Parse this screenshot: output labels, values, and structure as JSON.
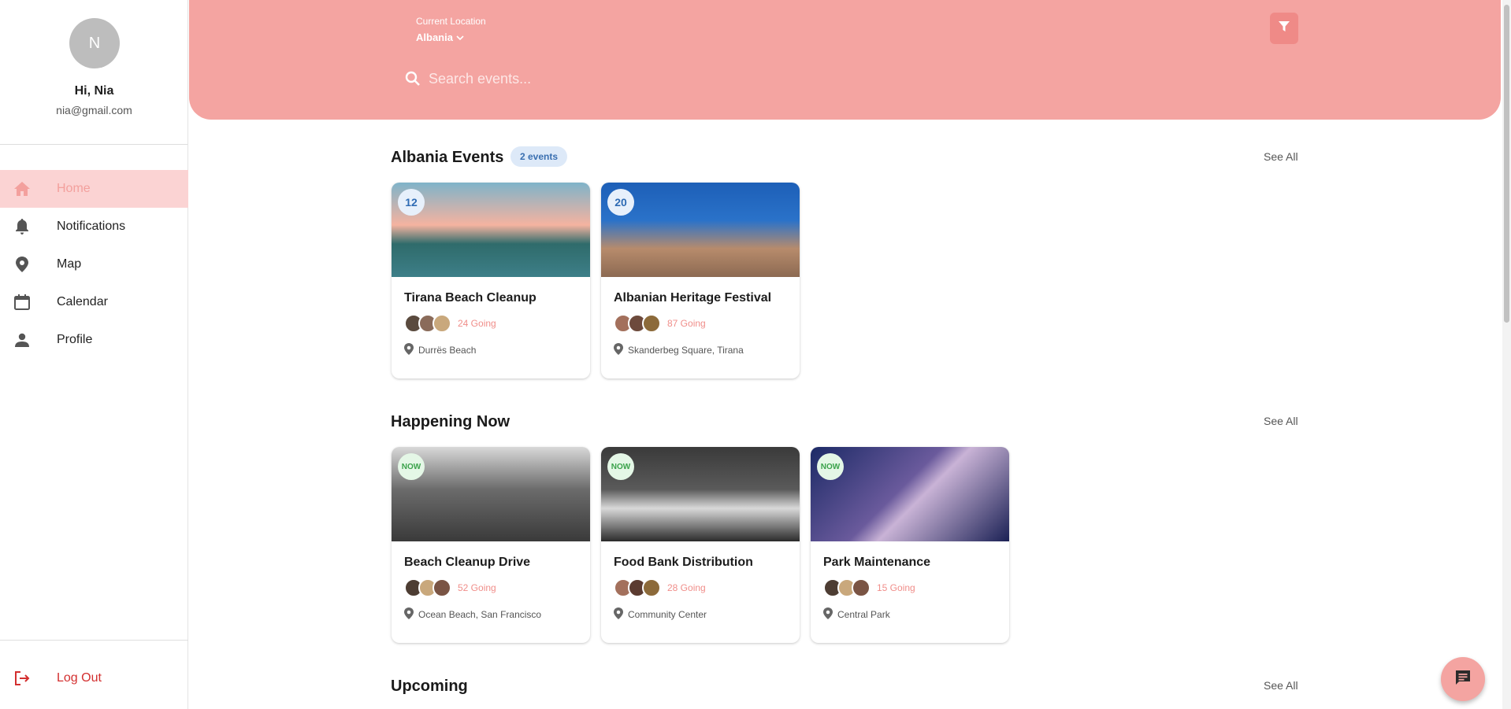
{
  "user": {
    "initial": "N",
    "greeting": "Hi, Nia",
    "email": "nia@gmail.com"
  },
  "nav": {
    "items": [
      {
        "label": "Home",
        "icon": "home-icon",
        "active": true
      },
      {
        "label": "Notifications",
        "icon": "bell-icon"
      },
      {
        "label": "Map",
        "icon": "map-pin-icon"
      },
      {
        "label": "Calendar",
        "icon": "calendar-icon"
      },
      {
        "label": "Profile",
        "icon": "person-icon"
      }
    ],
    "logout_label": "Log Out"
  },
  "header": {
    "location_caption": "Current Location",
    "location_value": "Albania",
    "search_placeholder": "Search events..."
  },
  "sections": {
    "albania": {
      "title": "Albania Events",
      "badge": "2 events",
      "see_all": "See All",
      "cards": [
        {
          "badge": "12",
          "title": "Tirana Beach Cleanup",
          "going": "24 Going",
          "place": "Durrës Beach"
        },
        {
          "badge": "20",
          "title": "Albanian Heritage Festival",
          "going": "87 Going",
          "place": "Skanderbeg Square, Tirana"
        }
      ]
    },
    "now": {
      "title": "Happening Now",
      "see_all": "See All",
      "cards": [
        {
          "badge": "NOW",
          "title": "Beach Cleanup Drive",
          "going": "52 Going",
          "place": "Ocean Beach, San Francisco"
        },
        {
          "badge": "NOW",
          "title": "Food Bank Distribution",
          "going": "28 Going",
          "place": "Community Center"
        },
        {
          "badge": "NOW",
          "title": "Park Maintenance",
          "going": "15 Going",
          "place": "Central Park"
        }
      ]
    },
    "upcoming": {
      "title": "Upcoming",
      "see_all": "See All"
    }
  },
  "colors": {
    "accent": "#f4a4a1",
    "active_nav_bg": "#fbd3d3",
    "logout": "#d32f2f"
  }
}
